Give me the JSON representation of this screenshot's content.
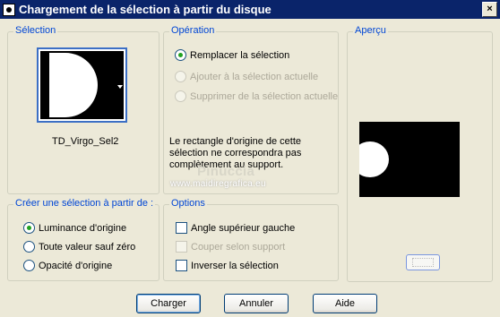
{
  "window": {
    "title": "Chargement de la sélection à partir du disque",
    "close_label": "×"
  },
  "selection": {
    "legend": "Sélection",
    "file_name": "TD_Virgo_Sel2"
  },
  "operation": {
    "legend": "Opération",
    "options": [
      {
        "label": "Remplacer la sélection",
        "checked": true,
        "enabled": true
      },
      {
        "label": "Ajouter à la sélection actuelle",
        "checked": false,
        "enabled": false
      },
      {
        "label": "Supprimer de la sélection actuelle",
        "checked": false,
        "enabled": false
      }
    ],
    "warning_line1": "Le rectangle d'origine de cette",
    "warning_line2": "sélection ne correspondra pas",
    "warning_line3": "complètement au support."
  },
  "preview": {
    "legend": "Aperçu"
  },
  "create_from": {
    "legend": "Créer une sélection à partir de :",
    "options": [
      {
        "label": "Luminance d'origine",
        "checked": true
      },
      {
        "label": "Toute valeur sauf zéro",
        "checked": false
      },
      {
        "label": "Opacité d'origine",
        "checked": false
      }
    ]
  },
  "options": {
    "legend": "Options",
    "items": [
      {
        "label": "Angle supérieur gauche",
        "checked": false,
        "enabled": true
      },
      {
        "label": "Couper selon support",
        "checked": false,
        "enabled": false
      },
      {
        "label": "Inverser la sélection",
        "checked": false,
        "enabled": true
      }
    ]
  },
  "watermark": {
    "name": "Pinuccia",
    "url": "www.maidiregrafica.eu"
  },
  "buttons": {
    "load": "Charger",
    "cancel": "Annuler",
    "help": "Aide"
  }
}
